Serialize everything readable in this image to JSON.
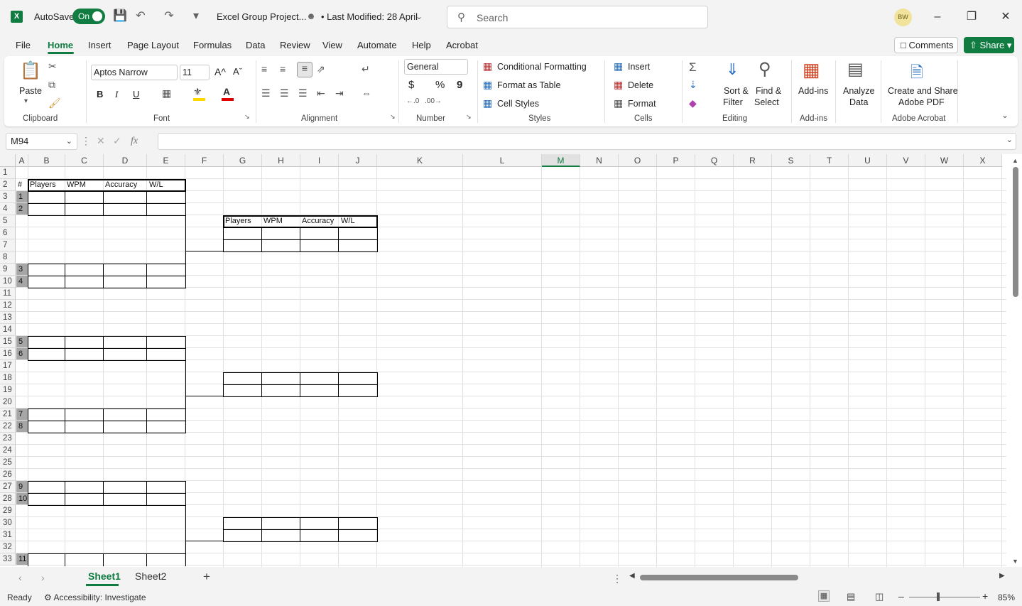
{
  "titlebar": {
    "app_logo": "X",
    "autosave_label": "AutoSave",
    "autosave_state": "On",
    "file_name": "Excel Group Project...",
    "last_modified": "• Last Modified: 28 April",
    "search_placeholder": "Search",
    "user_initials": "BW"
  },
  "tabs": [
    "File",
    "Home",
    "Insert",
    "Page Layout",
    "Formulas",
    "Data",
    "Review",
    "View",
    "Automate",
    "Help",
    "Acrobat"
  ],
  "actions": {
    "comments": "Comments",
    "share": "Share"
  },
  "ribbon": {
    "clipboard": {
      "paste": "Paste",
      "label": "Clipboard"
    },
    "font": {
      "name": "Aptos Narrow",
      "size": "11",
      "bold": "B",
      "italic": "I",
      "underline": "U",
      "label": "Font",
      "grow": "A^",
      "shrink": "Aˇ"
    },
    "alignment": {
      "label": "Alignment"
    },
    "number": {
      "format": "General",
      "currency": "$",
      "percent": "%",
      "comma": "9",
      "label": "Number"
    },
    "styles": {
      "conditional": "Conditional Formatting",
      "format_table": "Format as Table",
      "cell_styles": "Cell Styles",
      "label": "Styles"
    },
    "cells": {
      "insert": "Insert",
      "delete": "Delete",
      "format": "Format",
      "label": "Cells"
    },
    "editing": {
      "sort1": "Sort &",
      "sort2": "Filter",
      "find1": "Find &",
      "find2": "Select",
      "label": "Editing"
    },
    "addins": {
      "btn": "Add-ins",
      "label": "Add-ins"
    },
    "analyze": {
      "line1": "Analyze",
      "line2": "Data"
    },
    "acrobat": {
      "line1": "Create and Share",
      "line2": "Adobe PDF",
      "label": "Adobe Acrobat"
    }
  },
  "formula_bar": {
    "name_box": "M94",
    "fx": "fx",
    "value": ""
  },
  "columns": [
    "A",
    "B",
    "C",
    "D",
    "E",
    "F",
    "G",
    "H",
    "I",
    "J",
    "K",
    "L",
    "M",
    "N",
    "O",
    "P",
    "Q",
    "R",
    "S",
    "T",
    "U",
    "V",
    "W",
    "X"
  ],
  "selected_column": "M",
  "rows": [
    "1",
    "2",
    "3",
    "4",
    "5",
    "6",
    "7",
    "8",
    "9",
    "10",
    "11",
    "12",
    "13",
    "14",
    "15",
    "16",
    "17",
    "18",
    "19",
    "20",
    "21",
    "22",
    "23",
    "24",
    "25",
    "26",
    "27",
    "28",
    "29",
    "30",
    "31",
    "32",
    "33"
  ],
  "sheet": {
    "header_hash": "#",
    "left_headers": [
      "Players",
      "WPM",
      "Accuracy",
      "W/L"
    ],
    "right_headers": [
      "Players",
      "WPM",
      "Accuracy",
      "W/L"
    ],
    "seeds": [
      "1",
      "2",
      "3",
      "4",
      "5",
      "6",
      "7",
      "8",
      "9",
      "10",
      "11"
    ]
  },
  "sheet_tabs": [
    "Sheet1",
    "Sheet2"
  ],
  "status": {
    "ready": "Ready",
    "accessibility": "Accessibility: Investigate",
    "zoom": "85%"
  }
}
